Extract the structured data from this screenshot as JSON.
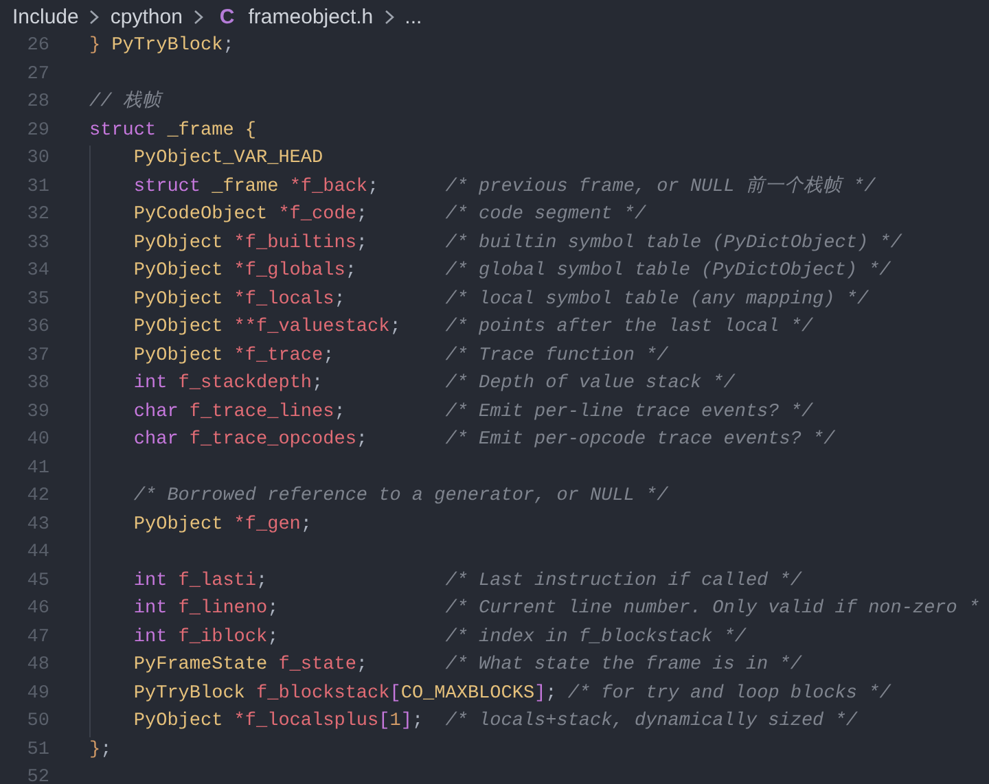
{
  "breadcrumb": {
    "items": [
      {
        "kind": "folder",
        "label": "Include"
      },
      {
        "kind": "folder",
        "label": "cpython"
      },
      {
        "kind": "file",
        "icon_text": "C",
        "label": "frameobject.h"
      },
      {
        "kind": "more",
        "label": "..."
      }
    ]
  },
  "editor": {
    "lines": [
      {
        "number": "26",
        "code": [
          {
            "kind": "brace",
            "text": "}"
          },
          {
            "kind": "type",
            "text": " PyTryBlock"
          },
          {
            "kind": "punct",
            "text": ";"
          }
        ]
      },
      {
        "number": "27"
      },
      {
        "number": "28",
        "comment": "// 栈帧"
      },
      {
        "number": "29",
        "code": [
          {
            "kind": "keyword",
            "text": "struct"
          },
          {
            "kind": "type",
            "text": " _frame"
          },
          {
            "kind": "type",
            "text": " {"
          }
        ],
        "children": [
          {
            "number": "30",
            "code": [
              {
                "kind": "type",
                "text": "PyObject_VAR_HEAD"
              }
            ]
          },
          {
            "number": "31",
            "code": [
              {
                "kind": "keyword",
                "text": "struct"
              },
              {
                "kind": "type",
                "text": " _frame"
              },
              {
                "kind": "variable",
                "text": " *f_back"
              },
              {
                "kind": "punct",
                "text": ";"
              }
            ],
            "comment": "/* previous frame, or NULL 前一个栈帧 */"
          },
          {
            "number": "32",
            "code": [
              {
                "kind": "type",
                "text": "PyCodeObject"
              },
              {
                "kind": "variable",
                "text": " *f_code"
              },
              {
                "kind": "punct",
                "text": ";"
              }
            ],
            "comment": "/* code segment */"
          },
          {
            "number": "33",
            "code": [
              {
                "kind": "type",
                "text": "PyObject"
              },
              {
                "kind": "variable",
                "text": " *f_builtins"
              },
              {
                "kind": "punct",
                "text": ";"
              }
            ],
            "comment": "/* builtin symbol table (PyDictObject) */"
          },
          {
            "number": "34",
            "code": [
              {
                "kind": "type",
                "text": "PyObject"
              },
              {
                "kind": "variable",
                "text": " *f_globals"
              },
              {
                "kind": "punct",
                "text": ";"
              }
            ],
            "comment": "/* global symbol table (PyDictObject) */"
          },
          {
            "number": "35",
            "code": [
              {
                "kind": "type",
                "text": "PyObject"
              },
              {
                "kind": "variable",
                "text": " *f_locals"
              },
              {
                "kind": "punct",
                "text": ";"
              }
            ],
            "comment": "/* local symbol table (any mapping) */"
          },
          {
            "number": "36",
            "code": [
              {
                "kind": "type",
                "text": "PyObject"
              },
              {
                "kind": "variable",
                "text": " **f_valuestack"
              },
              {
                "kind": "punct",
                "text": ";"
              }
            ],
            "comment": "/* points after the last local */"
          },
          {
            "number": "37",
            "code": [
              {
                "kind": "type",
                "text": "PyObject"
              },
              {
                "kind": "variable",
                "text": " *f_trace"
              },
              {
                "kind": "punct",
                "text": ";"
              }
            ],
            "comment": "/* Trace function */"
          },
          {
            "number": "38",
            "code": [
              {
                "kind": "keyword",
                "text": "int"
              },
              {
                "kind": "variable",
                "text": " f_stackdepth"
              },
              {
                "kind": "punct",
                "text": ";"
              }
            ],
            "comment": "/* Depth of value stack */"
          },
          {
            "number": "39",
            "code": [
              {
                "kind": "keyword",
                "text": "char"
              },
              {
                "kind": "variable",
                "text": " f_trace_lines"
              },
              {
                "kind": "punct",
                "text": ";"
              }
            ],
            "comment": "/* Emit per-line trace events? */"
          },
          {
            "number": "40",
            "code": [
              {
                "kind": "keyword",
                "text": "char"
              },
              {
                "kind": "variable",
                "text": " f_trace_opcodes"
              },
              {
                "kind": "punct",
                "text": ";"
              }
            ],
            "comment": "/* Emit per-opcode trace events? */"
          },
          {
            "number": "41"
          },
          {
            "number": "42",
            "comment": "/* Borrowed reference to a generator, or NULL */"
          },
          {
            "number": "43",
            "code": [
              {
                "kind": "type",
                "text": "PyObject"
              },
              {
                "kind": "variable",
                "text": " *f_gen"
              },
              {
                "kind": "punct",
                "text": ";"
              }
            ]
          },
          {
            "number": "44"
          },
          {
            "number": "45",
            "code": [
              {
                "kind": "keyword",
                "text": "int"
              },
              {
                "kind": "variable",
                "text": " f_lasti"
              },
              {
                "kind": "punct",
                "text": ";"
              }
            ],
            "comment": "/* Last instruction if called */"
          },
          {
            "number": "46",
            "code": [
              {
                "kind": "keyword",
                "text": "int"
              },
              {
                "kind": "variable",
                "text": " f_lineno"
              },
              {
                "kind": "punct",
                "text": ";"
              }
            ],
            "comment": "/* Current line number. Only valid if non-zero *"
          },
          {
            "number": "47",
            "code": [
              {
                "kind": "keyword",
                "text": "int"
              },
              {
                "kind": "variable",
                "text": " f_iblock"
              },
              {
                "kind": "punct",
                "text": ";"
              }
            ],
            "comment": "/* index in f_blockstack */"
          },
          {
            "number": "48",
            "code": [
              {
                "kind": "type",
                "text": "PyFrameState"
              },
              {
                "kind": "variable",
                "text": " f_state"
              },
              {
                "kind": "punct",
                "text": ";"
              }
            ],
            "comment": "/* What state the frame is in */"
          },
          {
            "number": "49",
            "code": [
              {
                "kind": "type",
                "text": "PyTryBlock"
              },
              {
                "kind": "variable",
                "text": " f_blockstack"
              },
              {
                "kind": "bracket",
                "text": "["
              },
              {
                "kind": "type",
                "text": "CO_MAXBLOCKS"
              },
              {
                "kind": "bracket",
                "text": "]"
              },
              {
                "kind": "punct",
                "text": ";"
              }
            ],
            "comment": "/* for try and loop blocks */"
          },
          {
            "number": "50",
            "code": [
              {
                "kind": "type",
                "text": "PyObject"
              },
              {
                "kind": "variable",
                "text": " *f_localsplus"
              },
              {
                "kind": "bracket",
                "text": "["
              },
              {
                "kind": "number",
                "text": "1"
              },
              {
                "kind": "bracket",
                "text": "]"
              },
              {
                "kind": "punct",
                "text": ";"
              }
            ],
            "comment": "/* locals+stack, dynamically sized */"
          }
        ]
      },
      {
        "number": "51",
        "code": [
          {
            "kind": "brace",
            "text": "}"
          },
          {
            "kind": "punct",
            "text": ";"
          }
        ]
      },
      {
        "number": "52"
      }
    ]
  }
}
